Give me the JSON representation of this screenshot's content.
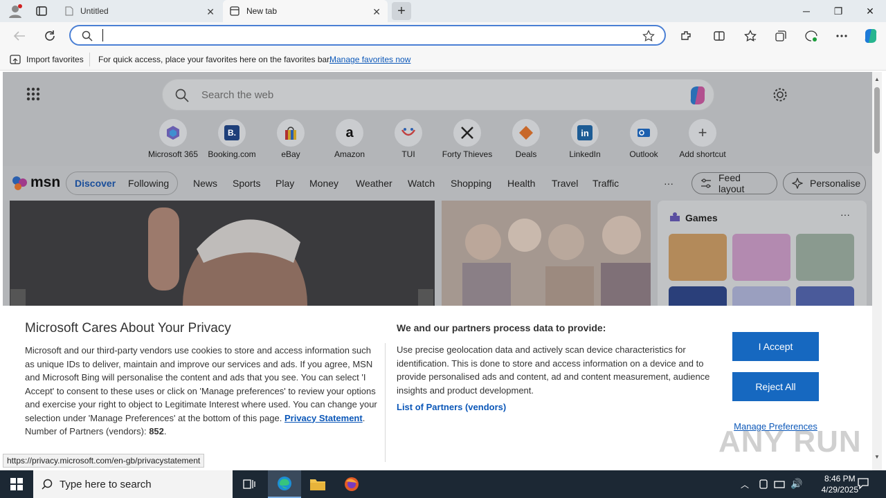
{
  "browser": {
    "tabs": [
      {
        "title": "Untitled"
      },
      {
        "title": "New tab"
      }
    ],
    "address_value": ""
  },
  "favorites_bar": {
    "import_label": "Import favorites",
    "message": "For quick access, place your favorites here on the favorites bar.",
    "manage_link": "Manage favorites now"
  },
  "newtab": {
    "search_placeholder": "Search the web",
    "shortcuts": [
      {
        "label": "Microsoft 365"
      },
      {
        "label": "Booking.com"
      },
      {
        "label": "eBay"
      },
      {
        "label": "Amazon"
      },
      {
        "label": "TUI"
      },
      {
        "label": "Forty Thieves"
      },
      {
        "label": "Deals"
      },
      {
        "label": "LinkedIn"
      },
      {
        "label": "Outlook"
      },
      {
        "label": "Add shortcut"
      }
    ],
    "msn": {
      "logo": "msn",
      "tabs": [
        "Discover",
        "Following"
      ],
      "nav": [
        "News",
        "Sports",
        "Play",
        "Money",
        "Weather",
        "Watch",
        "Shopping",
        "Health",
        "Travel",
        "Traffic"
      ],
      "more": "···",
      "feed_layout": "Feed layout",
      "personalise": "Personalise"
    },
    "games_title": "Games"
  },
  "privacy": {
    "title": "Microsoft Cares About Your Privacy",
    "body": "Microsoft and our third-party vendors use cookies to store and access information such as unique IDs to deliver, maintain and improve our services and ads. If you agree, MSN and Microsoft Bing will personalise the content and ads that you see. You can select 'I Accept' to consent to these uses or click on 'Manage preferences' to review your options and exercise your right to object to Legitimate Interest where used.  You can change your selection under 'Manage Preferences' at the bottom of this page.",
    "statement_link": "Privacy Statement",
    "partners_label": "Number of Partners (vendors):",
    "partners_count": "852",
    "right_heading": "We and our partners process data to provide:",
    "right_body": "Use precise geolocation data and actively scan device characteristics for identification. This is done to store and access information on a device and to provide personalised ads and content, ad and content measurement, audience insights and product development.",
    "partners_link": "List of Partners (vendors)",
    "accept": "I Accept",
    "reject": "Reject All",
    "manage": "Manage Preferences"
  },
  "status_url": "https://privacy.microsoft.com/en-gb/privacystatement",
  "watermark": "ANY RUN",
  "taskbar": {
    "search_placeholder": "Type here to search",
    "time": "8:46 PM",
    "date": "4/29/2025"
  }
}
